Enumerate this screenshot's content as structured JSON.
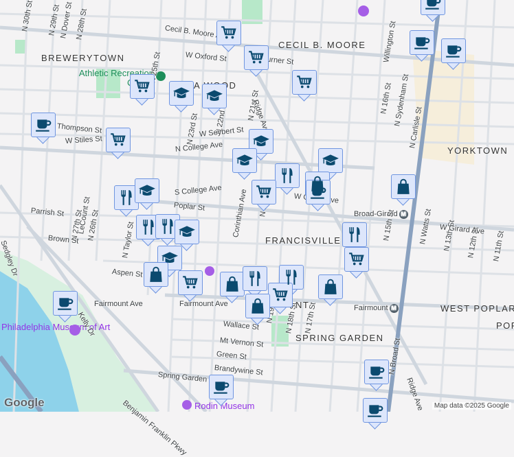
{
  "neighborhoods": [
    "BREWERYTOWN",
    "CECIL B. MOORE",
    "YORKTOWN",
    "FRANCISVILLE",
    "SPRING GARDEN",
    "WEST POPLAR",
    "POP",
    "A  WOOD",
    "NT"
  ],
  "pois": {
    "athletic": "Athletic Recreation Center",
    "museum": "Philadelphia Museum of Art",
    "rodin": "Rodin Museum"
  },
  "transit": {
    "broad_girard": "Broad-Girard",
    "fairmount": "Fairmount",
    "metro_symbol": "M"
  },
  "streets": [
    "N 30th St",
    "N 29th St",
    "N Dover St",
    "N 28th St",
    "N 25th St",
    "N 23rd St",
    "N 22nd St",
    "N 21st St",
    "N 20th St",
    "N 19th St",
    "N 18th St",
    "N 17th St",
    "N 16th St",
    "N Sydenham St",
    "N Carlisle St",
    "N Broad St",
    "N 15th St",
    "N Watts St",
    "N 13th St",
    "N 12th St",
    "N 11th St",
    "N 27th St",
    "N 26th St",
    "N Taylor St",
    "LeCount St",
    "Cecil B. Moore Ave",
    "W Oxford St",
    "Thompson St",
    "W Stiles St",
    "W Seybert St",
    "N College Ave",
    "S College Ave",
    "Poplar St",
    "Parrish St",
    "Brown St",
    "Aspen St",
    "Fairmount Ave",
    "Wallace St",
    "Mt Vernon St",
    "Green St",
    "Brandywine St",
    "Spring Garden St",
    "Kelly Dr",
    "Sedgley Dr",
    "Corinthian Ave",
    "Ridge Ave",
    "W Girard Ave",
    "Willington St",
    "Turner St",
    "Benjamin Franklin Pkwy"
  ],
  "markers": [
    "cart",
    "cart",
    "cart",
    "cart",
    "grad",
    "grad",
    "coffee",
    "cart",
    "grad",
    "grad",
    "food",
    "grad",
    "bag",
    "coffee",
    "cart",
    "food",
    "grad",
    "bag",
    "food",
    "cart",
    "food",
    "food",
    "grad",
    "grad",
    "bag",
    "cart",
    "bag",
    "food",
    "food",
    "cart",
    "bag",
    "bag",
    "coffee",
    "coffee",
    "coffee",
    "coffee",
    "coffee",
    "coffee",
    "coffee"
  ],
  "attribution": "Map data ©2025 Google",
  "logo": "Google",
  "colors": {
    "marker_fill": "#dde6fb",
    "marker_border": "#6f95e0",
    "icon": "#0b4a6f",
    "water": "#8ed2ea",
    "park": "#b7e8c9",
    "campus": "#f6eedb",
    "highway": "#8aa1bf"
  }
}
